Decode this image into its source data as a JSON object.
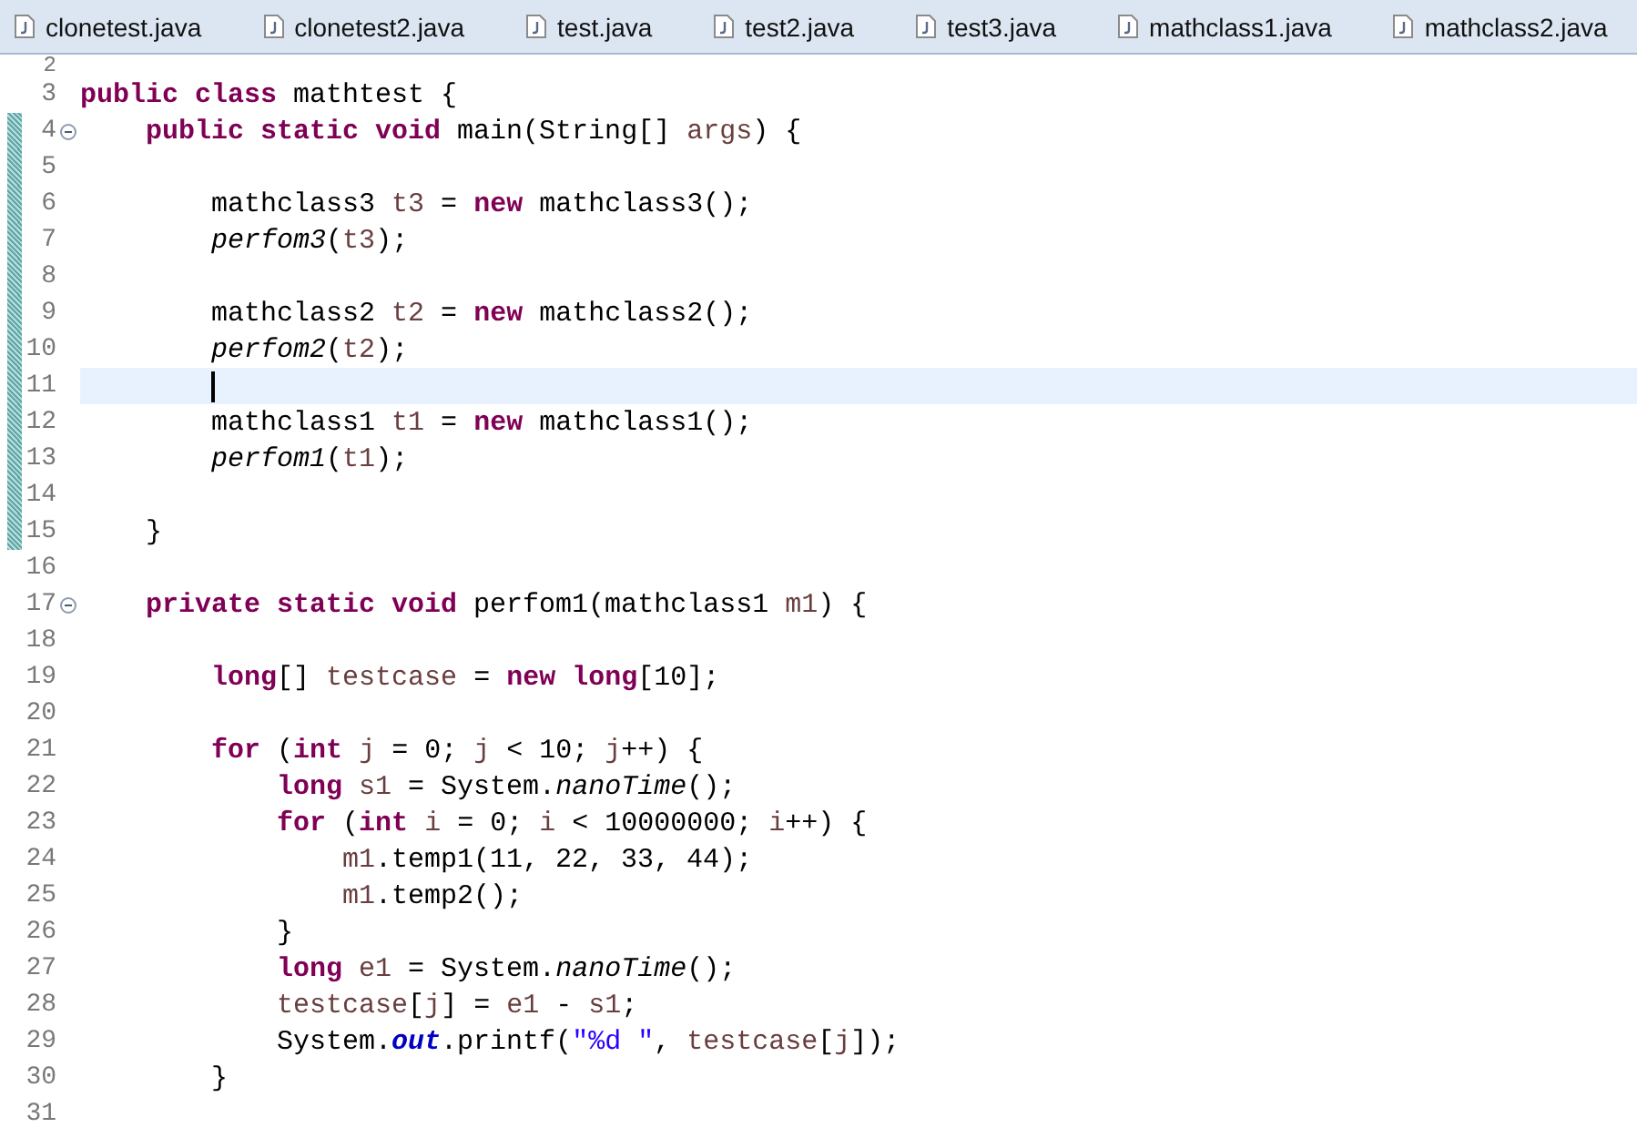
{
  "tabs": [
    {
      "label": "clonetest.java",
      "selected": false
    },
    {
      "label": "clonetest2.java",
      "selected": false
    },
    {
      "label": "test.java",
      "selected": false
    },
    {
      "label": "test2.java",
      "selected": false
    },
    {
      "label": "test3.java",
      "selected": false
    },
    {
      "label": "mathclass1.java",
      "selected": false
    },
    {
      "label": "mathclass2.java",
      "selected": false
    }
  ],
  "editor": {
    "lines": [
      {
        "number": "2",
        "changed": false,
        "fold": false,
        "current": false
      },
      {
        "number": "3",
        "changed": false,
        "fold": false,
        "current": false,
        "tokens": [
          {
            "kind": "kw",
            "text": "public class"
          },
          {
            "kind": "plain",
            "text": " mathtest {"
          }
        ]
      },
      {
        "number": "4",
        "changed": true,
        "fold": true,
        "current": false,
        "tokens": [
          {
            "kind": "kw",
            "text": "    public static void"
          },
          {
            "kind": "plain",
            "text": " main(String[] "
          },
          {
            "kind": "var",
            "text": "args"
          },
          {
            "kind": "plain",
            "text": ") {"
          }
        ]
      },
      {
        "number": "5",
        "changed": true,
        "fold": false,
        "current": false
      },
      {
        "number": "6",
        "changed": true,
        "fold": false,
        "current": false,
        "tokens": [
          {
            "kind": "plain",
            "text": "        mathclass3 "
          },
          {
            "kind": "var",
            "text": "t3"
          },
          {
            "kind": "plain",
            "text": " = "
          },
          {
            "kind": "kw",
            "text": "new"
          },
          {
            "kind": "plain",
            "text": " mathclass3();"
          }
        ]
      },
      {
        "number": "7",
        "changed": true,
        "fold": false,
        "current": false,
        "tokens": [
          {
            "kind": "smethod",
            "text": "        perfom3"
          },
          {
            "kind": "plain",
            "text": "("
          },
          {
            "kind": "var",
            "text": "t3"
          },
          {
            "kind": "plain",
            "text": ");"
          }
        ]
      },
      {
        "number": "8",
        "changed": true,
        "fold": false,
        "current": false
      },
      {
        "number": "9",
        "changed": true,
        "fold": false,
        "current": false,
        "tokens": [
          {
            "kind": "plain",
            "text": "        mathclass2 "
          },
          {
            "kind": "var",
            "text": "t2"
          },
          {
            "kind": "plain",
            "text": " = "
          },
          {
            "kind": "kw",
            "text": "new"
          },
          {
            "kind": "plain",
            "text": " mathclass2();"
          }
        ]
      },
      {
        "number": "10",
        "changed": true,
        "fold": false,
        "current": false,
        "tokens": [
          {
            "kind": "smethod",
            "text": "        perfom2"
          },
          {
            "kind": "plain",
            "text": "("
          },
          {
            "kind": "var",
            "text": "t2"
          },
          {
            "kind": "plain",
            "text": ");"
          }
        ]
      },
      {
        "number": "11",
        "changed": true,
        "fold": false,
        "current": true
      },
      {
        "number": "12",
        "changed": true,
        "fold": false,
        "current": false,
        "tokens": [
          {
            "kind": "plain",
            "text": "        mathclass1 "
          },
          {
            "kind": "var",
            "text": "t1"
          },
          {
            "kind": "plain",
            "text": " = "
          },
          {
            "kind": "kw",
            "text": "new"
          },
          {
            "kind": "plain",
            "text": " mathclass1();"
          }
        ]
      },
      {
        "number": "13",
        "changed": true,
        "fold": false,
        "current": false,
        "tokens": [
          {
            "kind": "smethod",
            "text": "        perfom1"
          },
          {
            "kind": "plain",
            "text": "("
          },
          {
            "kind": "var",
            "text": "t1"
          },
          {
            "kind": "plain",
            "text": ");"
          }
        ]
      },
      {
        "number": "14",
        "changed": true,
        "fold": false,
        "current": false
      },
      {
        "number": "15",
        "changed": true,
        "fold": false,
        "current": false,
        "tokens": [
          {
            "kind": "plain",
            "text": "    }"
          }
        ]
      },
      {
        "number": "16",
        "changed": false,
        "fold": false,
        "current": false
      },
      {
        "number": "17",
        "changed": false,
        "fold": true,
        "current": false,
        "tokens": [
          {
            "kind": "kw",
            "text": "    private static void"
          },
          {
            "kind": "plain",
            "text": " perfom1(mathclass1 "
          },
          {
            "kind": "var",
            "text": "m1"
          },
          {
            "kind": "plain",
            "text": ") {"
          }
        ]
      },
      {
        "number": "18",
        "changed": false,
        "fold": false,
        "current": false
      },
      {
        "number": "19",
        "changed": false,
        "fold": false,
        "current": false,
        "tokens": [
          {
            "kind": "kw",
            "text": "        long"
          },
          {
            "kind": "plain",
            "text": "[] "
          },
          {
            "kind": "var",
            "text": "testcase"
          },
          {
            "kind": "plain",
            "text": " = "
          },
          {
            "kind": "kw",
            "text": "new long"
          },
          {
            "kind": "plain",
            "text": "[10];"
          }
        ]
      },
      {
        "number": "20",
        "changed": false,
        "fold": false,
        "current": false
      },
      {
        "number": "21",
        "changed": false,
        "fold": false,
        "current": false,
        "tokens": [
          {
            "kind": "kw",
            "text": "        for"
          },
          {
            "kind": "plain",
            "text": " ("
          },
          {
            "kind": "kw",
            "text": "int"
          },
          {
            "kind": "var",
            "text": " j"
          },
          {
            "kind": "plain",
            "text": " = 0; "
          },
          {
            "kind": "var",
            "text": "j"
          },
          {
            "kind": "plain",
            "text": " < 10; "
          },
          {
            "kind": "var",
            "text": "j"
          },
          {
            "kind": "plain",
            "text": "++) {"
          }
        ]
      },
      {
        "number": "22",
        "changed": false,
        "fold": false,
        "current": false,
        "tokens": [
          {
            "kind": "kw",
            "text": "            long"
          },
          {
            "kind": "var",
            "text": " s1"
          },
          {
            "kind": "plain",
            "text": " = System."
          },
          {
            "kind": "smethod",
            "text": "nanoTime"
          },
          {
            "kind": "plain",
            "text": "();"
          }
        ]
      },
      {
        "number": "23",
        "changed": false,
        "fold": false,
        "current": false,
        "tokens": [
          {
            "kind": "kw",
            "text": "            for"
          },
          {
            "kind": "plain",
            "text": " ("
          },
          {
            "kind": "kw",
            "text": "int"
          },
          {
            "kind": "var",
            "text": " i"
          },
          {
            "kind": "plain",
            "text": " = 0; "
          },
          {
            "kind": "var",
            "text": "i"
          },
          {
            "kind": "plain",
            "text": " < 10000000; "
          },
          {
            "kind": "var",
            "text": "i"
          },
          {
            "kind": "plain",
            "text": "++) {"
          }
        ]
      },
      {
        "number": "24",
        "changed": false,
        "fold": false,
        "current": false,
        "tokens": [
          {
            "kind": "var",
            "text": "                m1"
          },
          {
            "kind": "plain",
            "text": ".temp1(11, 22, 33, 44);"
          }
        ]
      },
      {
        "number": "25",
        "changed": false,
        "fold": false,
        "current": false,
        "tokens": [
          {
            "kind": "var",
            "text": "                m1"
          },
          {
            "kind": "plain",
            "text": ".temp2();"
          }
        ]
      },
      {
        "number": "26",
        "changed": false,
        "fold": false,
        "current": false,
        "tokens": [
          {
            "kind": "plain",
            "text": "            }"
          }
        ]
      },
      {
        "number": "27",
        "changed": false,
        "fold": false,
        "current": false,
        "tokens": [
          {
            "kind": "kw",
            "text": "            long"
          },
          {
            "kind": "var",
            "text": " e1"
          },
          {
            "kind": "plain",
            "text": " = System."
          },
          {
            "kind": "smethod",
            "text": "nanoTime"
          },
          {
            "kind": "plain",
            "text": "();"
          }
        ]
      },
      {
        "number": "28",
        "changed": false,
        "fold": false,
        "current": false,
        "tokens": [
          {
            "kind": "var",
            "text": "            testcase"
          },
          {
            "kind": "plain",
            "text": "["
          },
          {
            "kind": "var",
            "text": "j"
          },
          {
            "kind": "plain",
            "text": "] = "
          },
          {
            "kind": "var",
            "text": "e1"
          },
          {
            "kind": "plain",
            "text": " - "
          },
          {
            "kind": "var",
            "text": "s1"
          },
          {
            "kind": "plain",
            "text": ";"
          }
        ]
      },
      {
        "number": "29",
        "changed": false,
        "fold": false,
        "current": false,
        "tokens": [
          {
            "kind": "plain",
            "text": "            System."
          },
          {
            "kind": "field",
            "text": "out"
          },
          {
            "kind": "plain",
            "text": ".printf("
          },
          {
            "kind": "str",
            "text": "\"%d \""
          },
          {
            "kind": "plain",
            "text": ", "
          },
          {
            "kind": "var",
            "text": "testcase"
          },
          {
            "kind": "plain",
            "text": "["
          },
          {
            "kind": "var",
            "text": "j"
          },
          {
            "kind": "plain",
            "text": "]);"
          }
        ]
      },
      {
        "number": "30",
        "changed": false,
        "fold": false,
        "current": false,
        "tokens": [
          {
            "kind": "plain",
            "text": "        }"
          }
        ]
      },
      {
        "number": "31",
        "changed": false,
        "fold": false,
        "current": false
      }
    ]
  }
}
